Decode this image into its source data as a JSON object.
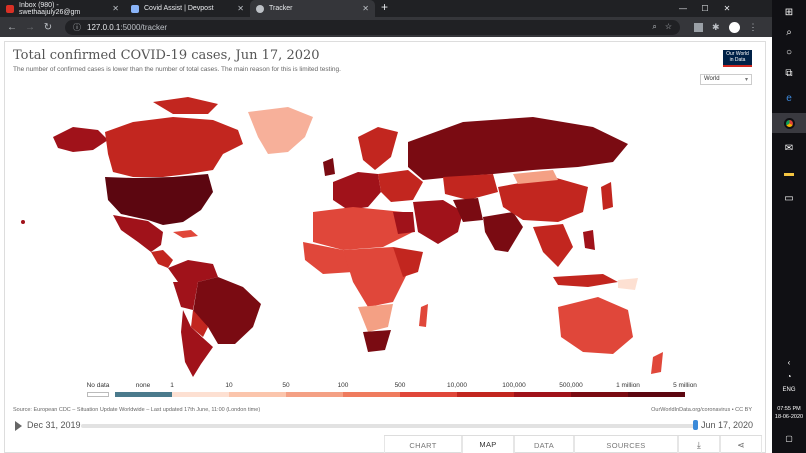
{
  "browser": {
    "tabs": [
      {
        "title": "Inbox (980) - swethaajuly26@gm",
        "icon": "gmail-icon",
        "color": "#d93025",
        "active": false
      },
      {
        "title": "Covid Assist | Devpost",
        "icon": "devpost-icon",
        "color": "#8ab4f8",
        "active": false
      },
      {
        "title": "Tracker",
        "icon": "globe-icon",
        "color": "#bdc1c6",
        "active": true
      }
    ],
    "url_host": "127.0.0.1",
    "url_path": ":5000/tracker"
  },
  "chart": {
    "title": "Total confirmed COVID-19 cases, Jun 17, 2020",
    "subtitle": "The number of confirmed cases is lower than the number of total cases. The main reason for this is limited testing.",
    "logo_line1": "Our World",
    "logo_line2": "in Data",
    "region_select": "World",
    "source": "Source: European CDC – Situation Update Worldwide – Last updated 17th June, 11:00 (London time)",
    "source_right": "OurWorldInData.org/coronavirus • CC BY",
    "timeline_start": "Dec 31, 2019",
    "timeline_end": "Jun 17, 2020",
    "timeline_progress": 1.0,
    "tabs": [
      "CHART",
      "MAP",
      "DATA",
      "SOURCES"
    ],
    "active_tab": "MAP"
  },
  "chart_data": {
    "type": "heatmap",
    "title": "Total confirmed COVID-19 cases, Jun 17, 2020",
    "legend": {
      "no_data_label": "No data",
      "bins": [
        "none",
        "1",
        "10",
        "50",
        "100",
        "500",
        "10,000",
        "100,000",
        "500,000",
        "1 million",
        "5 million"
      ],
      "colors": [
        "#4a7a8c",
        "#fde0d2",
        "#fbc5ac",
        "#f4a084",
        "#ef7b5e",
        "#e0473a",
        "#c2261f",
        "#a0121a",
        "#7a0b12",
        "#5c0610"
      ]
    },
    "regions": [
      {
        "name": "United States",
        "level": "1 million+"
      },
      {
        "name": "Brazil",
        "level": "500,000 - 1 million"
      },
      {
        "name": "Russia",
        "level": "500,000 - 1 million"
      },
      {
        "name": "India",
        "level": "100,000 - 500,000"
      },
      {
        "name": "Canada",
        "level": "10,000 - 100,000"
      },
      {
        "name": "Greenland",
        "level": "10 - 50"
      },
      {
        "name": "Australia",
        "level": "500 - 10,000"
      },
      {
        "name": "China",
        "level": "10,000 - 100,000"
      }
    ]
  },
  "taskbar": {
    "lang": "ENG",
    "time": "07:55 PM",
    "date": "18-06-2020"
  }
}
